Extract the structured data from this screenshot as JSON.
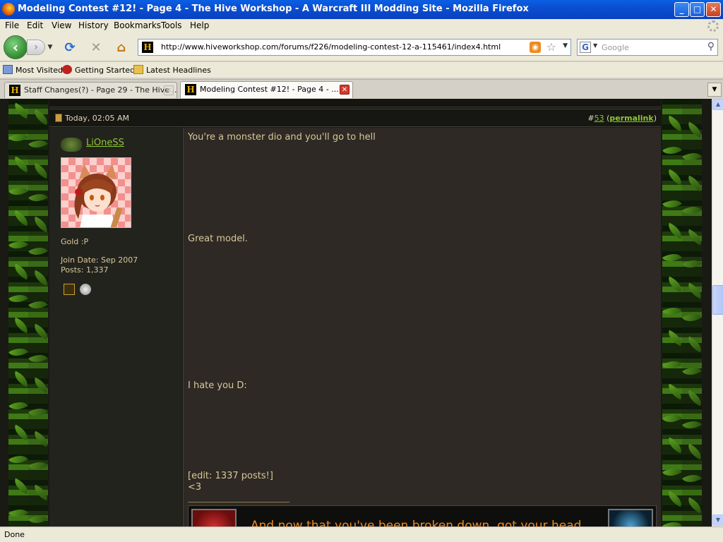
{
  "window": {
    "title": "Modeling Contest #12! - Page 4 - The Hive Workshop - A Warcraft III Modding Site - Mozilla Firefox",
    "minimize": "_",
    "maximize": "□",
    "close": "✕"
  },
  "menu": [
    "File",
    "Edit",
    "View",
    "History",
    "Bookmarks",
    "Tools",
    "Help"
  ],
  "nav": {
    "url": "http://www.hiveworkshop.com/forums/f226/modeling-contest-12-a-115461/index4.html",
    "search_placeholder": "Google",
    "site_icon_letter": "H",
    "search_engine_letter": "G"
  },
  "bookmarks": [
    "Most Visited",
    "Getting Started",
    "Latest Headlines"
  ],
  "tabs": [
    {
      "label": "Staff Changes(?) - Page 29 - The Hive ...",
      "active": false
    },
    {
      "label": "Modeling Contest #12! - Page 4 - ...",
      "active": true
    }
  ],
  "post": {
    "date": "Today, 02:05 AM",
    "number_prefix": "#",
    "number": "53",
    "permalink": "permalink",
    "permalink_open": "(",
    "permalink_close": ")",
    "user": {
      "name": "LiOneSS",
      "rank": "Gold :P",
      "join_date": "Join Date: Sep 2007",
      "posts": "Posts: 1,337"
    },
    "body": {
      "line1": "You're a monster dio and you'll go to hell",
      "line2": "Great model.",
      "line3": "I hate you D:",
      "line4": "[edit: 1337 posts!]",
      "line5": "<3"
    },
    "signature_text": "And now that you've been broken down, got your head"
  },
  "status": {
    "text": "Done"
  },
  "colors": {
    "link_green": "#8cc832",
    "post_text": "#d8c89a",
    "signature_orange": "#f08a1e",
    "titlebar_blue": "#0a4fd0"
  },
  "icons": [
    "firefox-icon",
    "back-arrow-icon",
    "forward-arrow-icon",
    "reload-icon",
    "stop-icon",
    "home-icon",
    "rss-icon",
    "star-icon",
    "search-magnifier-icon",
    "folder-icon",
    "tab-close-icon"
  ]
}
